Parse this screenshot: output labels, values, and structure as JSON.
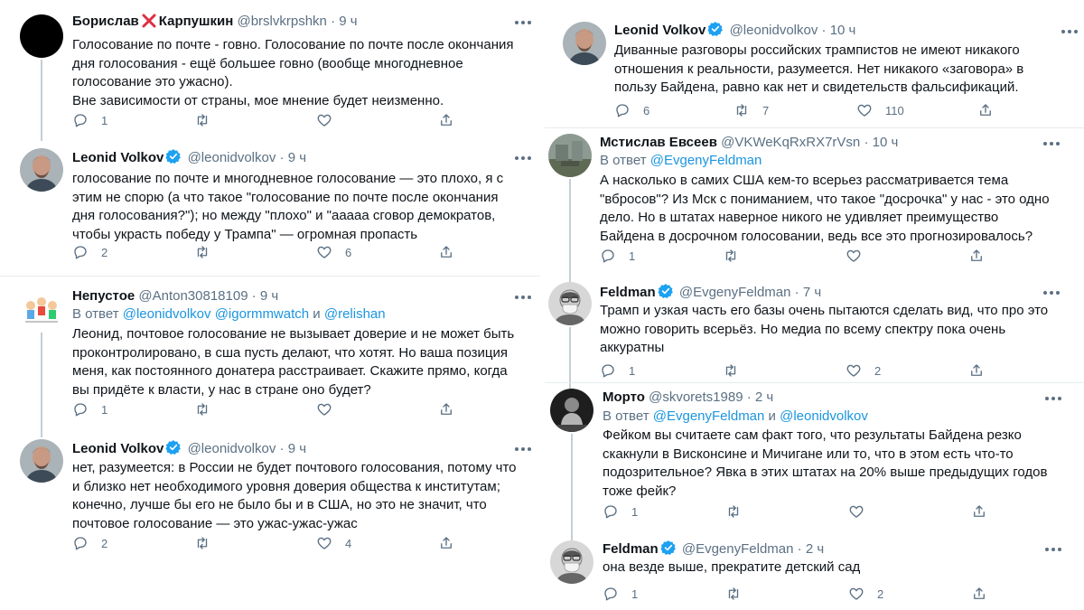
{
  "left": [
    {
      "name": "Борислав",
      "name2": "Карпушкин",
      "has_x": true,
      "verified": false,
      "handle": "@brslvkrpshkn",
      "time": "9 ч",
      "reply_to": null,
      "text": "Голосование по почте - говно. Голосование по почте после окончания\nдня голосования - ещё большее говно (вообще многодневное\nголосование это ужасно).\nВне зависимости от страны, мое мнение будет неизменно.",
      "replies": "1",
      "retweets": "",
      "likes": "",
      "avatar": "black"
    },
    {
      "name": "Leonid Volkov",
      "verified": true,
      "handle": "@leonidvolkov",
      "time": "9 ч",
      "reply_to": null,
      "text": "голосование по почте и многодневное голосование — это плохо, я с\nэтим не спорю (а что такое \"голосование по почте после окончания\nдня голосования?\"); но между \"плохо\" и \"ааааа сговор демократов,\nчтобы украсть победу у Трампа\" — огромная пропасть",
      "replies": "2",
      "retweets": "",
      "likes": "6",
      "avatar": "volkov"
    },
    {
      "name": "Непустое",
      "verified": false,
      "handle": "@Anton30818109",
      "time": "9 ч",
      "reply_to": {
        "prefix": "В ответ",
        "users": [
          "@leonidvolkov",
          "@igormmwatch"
        ],
        "conj": "и",
        "last": "@relishan"
      },
      "text": "Леонид, почтовое голосование не вызывает доверие и не может быть\nпроконтролировано, в сша пусть делают, что хотят. Но ваша позиция\nменя, как постоянного донатера расстраивает. Скажите прямо, когда\nвы придёте  к власти, у нас в стране оно будет?",
      "replies": "1",
      "retweets": "",
      "likes": "",
      "avatar": "cartoon"
    },
    {
      "name": "Leonid Volkov",
      "verified": true,
      "handle": "@leonidvolkov",
      "time": "9 ч",
      "reply_to": null,
      "text": "нет, разумеется: в России не будет почтового голосования, потому что\nи близко нет необходимого уровня доверия общества к институтам;\nконечно, лучше бы его не было бы и в США, но это не значит, что\nпочтовое голосование — это ужас-ужас-ужас",
      "replies": "2",
      "retweets": "",
      "likes": "4",
      "avatar": "volkov"
    }
  ],
  "right": [
    {
      "name": "Leonid Volkov",
      "verified": true,
      "handle": "@leonidvolkov",
      "time": "10 ч",
      "reply_to": null,
      "text": "Диванные разговоры российских трампистов не имеют никакого\nотношения к реальности, разумеется. Нет никакого «заговора» в\nпользу Байдена, равно как нет и свидетельств фальсификаций.",
      "replies": "6",
      "retweets": "7",
      "likes": "110",
      "avatar": "volkov"
    },
    {
      "name": "Мстислав Евсеев",
      "verified": false,
      "handle": "@VKWeKqRxRX7rVsn",
      "time": "10 ч",
      "reply_to": {
        "prefix": "В ответ",
        "users": [],
        "conj": "",
        "last": "@EvgenyFeldman"
      },
      "text": "А насколько в самих США кем-то всерьез рассматривается тема\n\"вбросов\"? Из Мск с пониманием, что такое \"досрочка\" у нас - это одно\nдело. Но в штатах наверное никого не удивляет преимущество\nБайдена в досрочном голосовании, ведь все это прогнозировалось?",
      "replies": "1",
      "retweets": "",
      "likes": "",
      "avatar": "landscape"
    },
    {
      "name": "Feldman",
      "verified": true,
      "handle": "@EvgenyFeldman",
      "time": "7 ч",
      "reply_to": null,
      "text": "Трамп и узкая часть его базы очень пытаются сделать вид, что про это\nможно говорить всерьёз. Но медиа по всему спектру пока очень\nаккуратны",
      "replies": "1",
      "retweets": "",
      "likes": "2",
      "avatar": "feldman"
    },
    {
      "name": "Морто",
      "verified": false,
      "handle": "@skvorets1989",
      "time": "2 ч",
      "reply_to": {
        "prefix": "В ответ",
        "users": [
          "@EvgenyFeldman"
        ],
        "conj": "и",
        "last": "@leonidvolkov"
      },
      "text": "Фейком вы считаете сам факт того, что результаты Байдена резко\nскакнули в Висконсине и Мичигане или то, что в этом есть что-то\nподозрительное? Явка в этих штатах на 20% выше предыдущих годов\nтоже фейк?",
      "replies": "1",
      "retweets": "",
      "likes": "",
      "avatar": "bw"
    },
    {
      "name": "Feldman",
      "verified": true,
      "handle": "@EvgenyFeldman",
      "time": "2 ч",
      "reply_to": null,
      "text": "она везде выше, прекратите детский сад",
      "replies": "1",
      "retweets": "",
      "likes": "2",
      "avatar": "feldman"
    }
  ],
  "dot": "·",
  "colors": {
    "link": "#1b95e0",
    "verified": "#1da1f2",
    "muted": "#5b7083",
    "line": "#c4cfd6"
  }
}
